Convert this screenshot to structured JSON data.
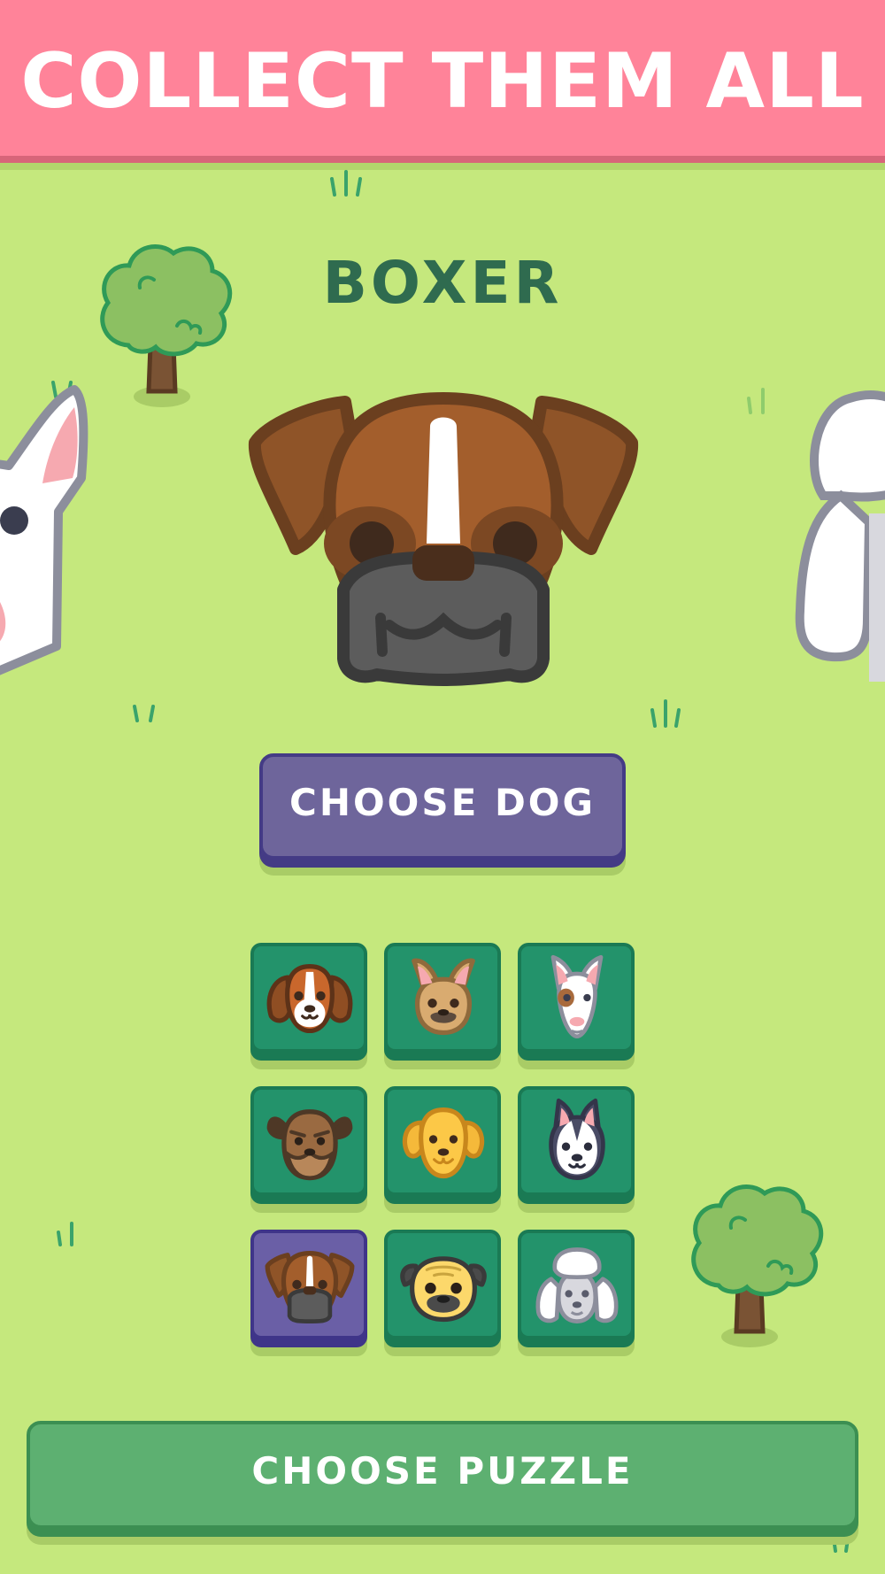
{
  "banner": {
    "title": "COLLECT THEM ALL"
  },
  "selected_dog": {
    "name": "BOXER"
  },
  "buttons": {
    "choose_dog": "CHOOSE DOG",
    "choose_puzzle": "CHOOSE PUZZLE"
  },
  "dog_grid": [
    {
      "breed": "beagle",
      "icon": "beagle-icon"
    },
    {
      "breed": "french-bulldog",
      "icon": "french-bulldog-icon"
    },
    {
      "breed": "bull-terrier",
      "icon": "bull-terrier-icon"
    },
    {
      "breed": "terrier",
      "icon": "terrier-icon"
    },
    {
      "breed": "golden-retriever",
      "icon": "golden-retriever-icon"
    },
    {
      "breed": "husky",
      "icon": "husky-icon"
    },
    {
      "breed": "boxer",
      "icon": "boxer-icon",
      "selected": true
    },
    {
      "breed": "pug",
      "icon": "pug-icon"
    },
    {
      "breed": "poodle",
      "icon": "poodle-icon"
    }
  ],
  "colors": {
    "background": "#c5e87d",
    "banner": "#ff8399",
    "choose_dog_button": "#6e659b",
    "choose_puzzle_button": "#5db071",
    "tile": "#23936b",
    "tile_selected": "#6a5fa6",
    "title_text": "#2f6b4f"
  }
}
